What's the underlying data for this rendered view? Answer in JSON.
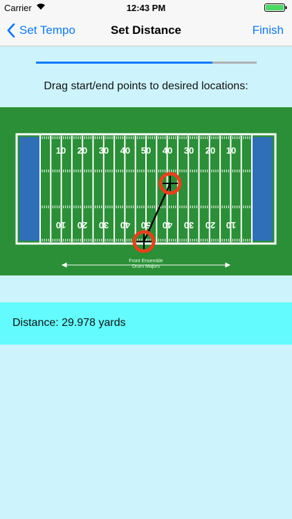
{
  "status": {
    "carrier": "Carrier",
    "time": "12:43 PM"
  },
  "nav": {
    "back_label": "Set Tempo",
    "title": "Set Distance",
    "finish_label": "Finish"
  },
  "progress": 0.8,
  "instructions": "Drag start/end points to desired locations:",
  "field": {
    "yard_numbers": [
      "10",
      "20",
      "30",
      "40",
      "50",
      "40",
      "30",
      "20",
      "10"
    ],
    "front_label_1": "Front Ensemble",
    "front_label_2": "Drum Majors"
  },
  "distance": {
    "text": "Distance: 29.978 yards"
  },
  "colors": {
    "accent": "#0a7aff",
    "field": "#2a8f36",
    "endzone": "#2f6fb8",
    "marker": "#e8401c"
  }
}
